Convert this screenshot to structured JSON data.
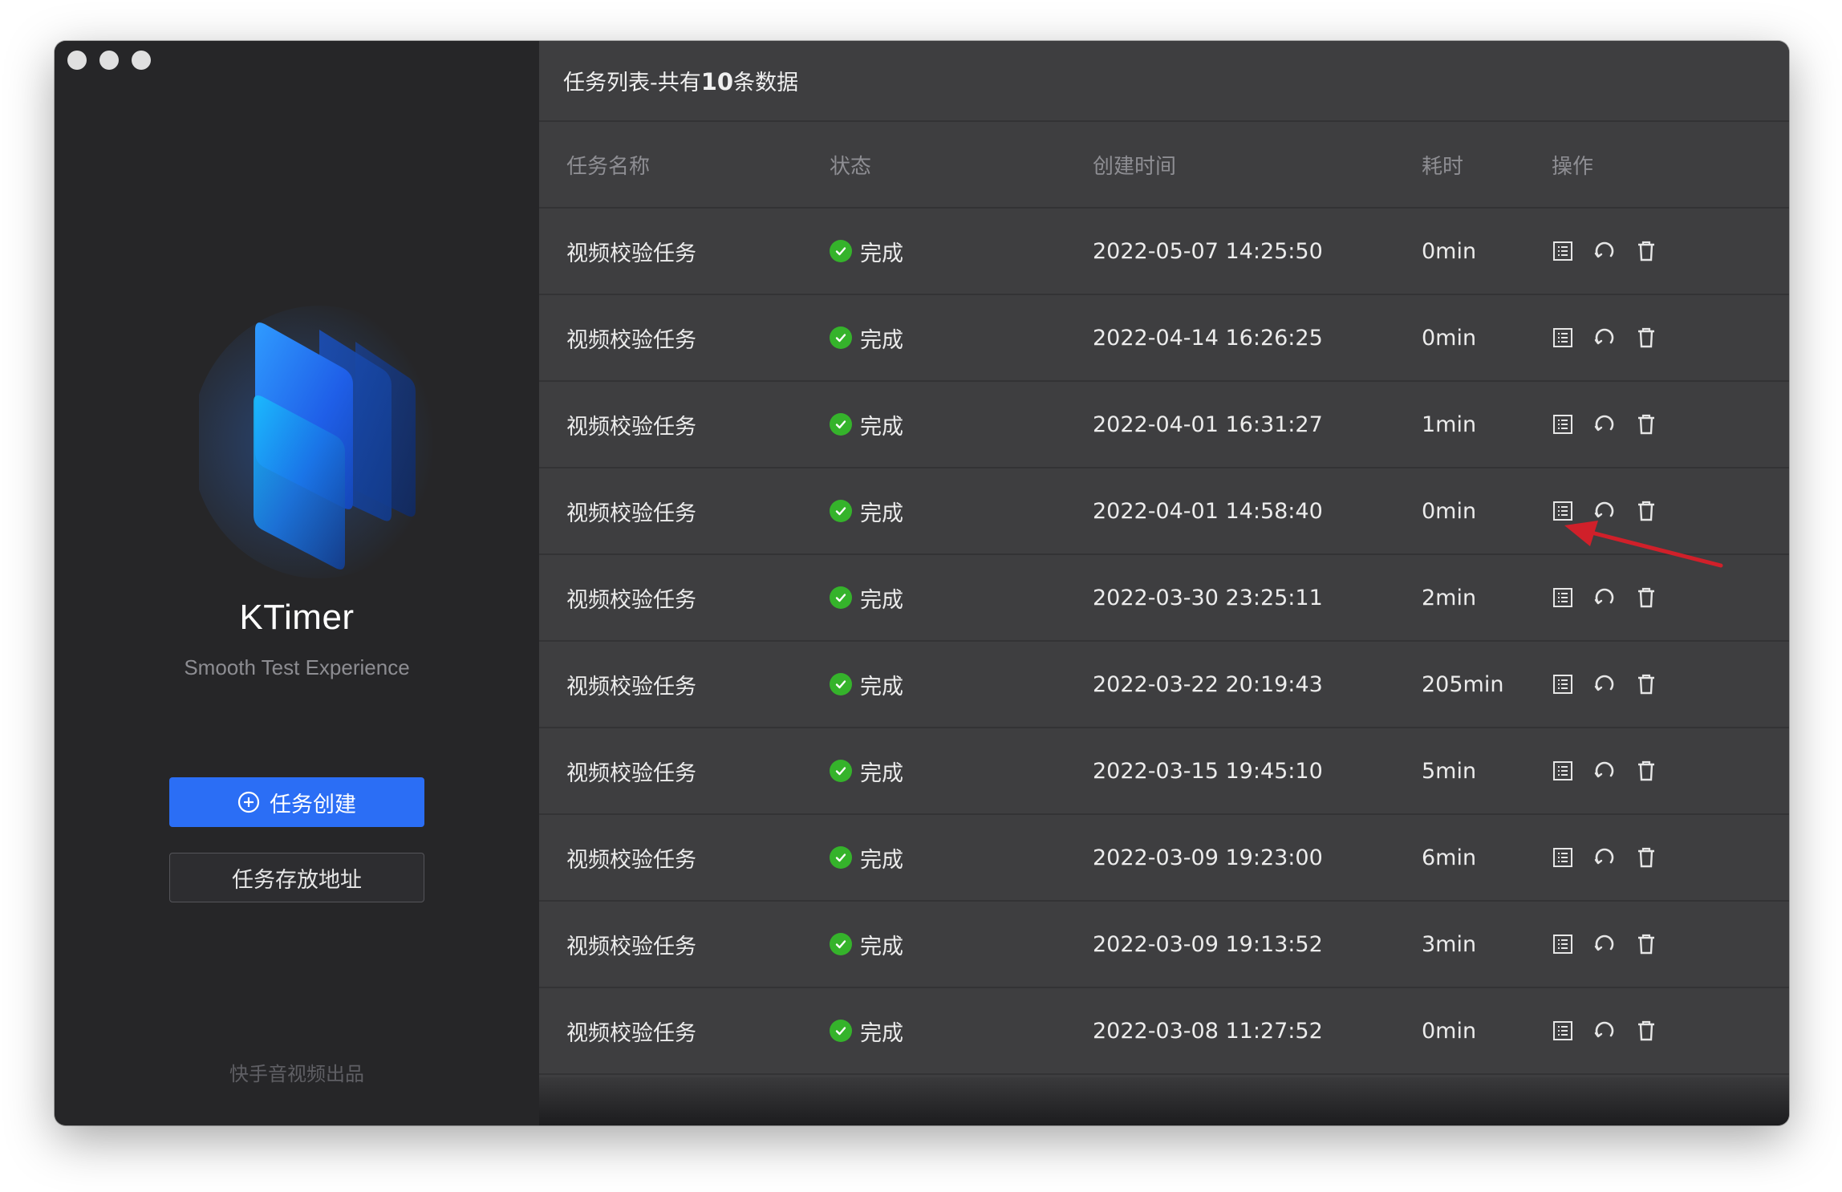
{
  "app": {
    "name": "KTimer",
    "tagline": "Smooth Test Experience",
    "create_button": "任务创建",
    "storage_button": "任务存放地址",
    "footer": "快手音视频出品"
  },
  "list": {
    "title_prefix": "任务列表-共有",
    "count": "10",
    "title_suffix": "条数据",
    "columns": {
      "name": "任务名称",
      "status": "状态",
      "created": "创建时间",
      "duration": "耗时",
      "actions": "操作"
    },
    "rows": [
      {
        "name": "视频校验任务",
        "status": "完成",
        "created": "2022-05-07 14:25:50",
        "duration": "0min"
      },
      {
        "name": "视频校验任务",
        "status": "完成",
        "created": "2022-04-14 16:26:25",
        "duration": "0min"
      },
      {
        "name": "视频校验任务",
        "status": "完成",
        "created": "2022-04-01 16:31:27",
        "duration": "1min"
      },
      {
        "name": "视频校验任务",
        "status": "完成",
        "created": "2022-04-01 14:58:40",
        "duration": "0min"
      },
      {
        "name": "视频校验任务",
        "status": "完成",
        "created": "2022-03-30 23:25:11",
        "duration": "2min"
      },
      {
        "name": "视频校验任务",
        "status": "完成",
        "created": "2022-03-22 20:19:43",
        "duration": "205min"
      },
      {
        "name": "视频校验任务",
        "status": "完成",
        "created": "2022-03-15 19:45:10",
        "duration": "5min"
      },
      {
        "name": "视频校验任务",
        "status": "完成",
        "created": "2022-03-09 19:23:00",
        "duration": "6min"
      },
      {
        "name": "视频校验任务",
        "status": "完成",
        "created": "2022-03-09 19:13:52",
        "duration": "3min"
      },
      {
        "name": "视频校验任务",
        "status": "完成",
        "created": "2022-03-08 11:27:52",
        "duration": "0min"
      }
    ]
  },
  "icons": {
    "detail": "list-detail-icon",
    "retry": "refresh-icon",
    "delete": "trash-icon",
    "status_done": "check-circle-icon"
  },
  "colors": {
    "accent": "#2b6ef5",
    "success": "#35b32b",
    "sidebar_bg": "#262628",
    "main_bg": "#3e3e40",
    "annotation_arrow": "#d0202a"
  }
}
